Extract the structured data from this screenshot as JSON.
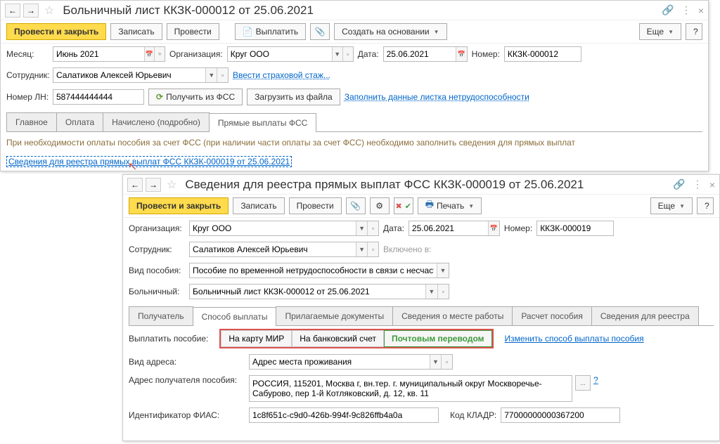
{
  "w1": {
    "title": "Больничный лист ККЗК-000012 от 25.06.2021",
    "toolbar": {
      "post_close": "Провести и закрыть",
      "write": "Записать",
      "post": "Провести",
      "payout": "Выплатить",
      "create_base": "Создать на основании",
      "more": "Еще",
      "help": "?"
    },
    "row1": {
      "month_lbl": "Месяц:",
      "month_val": "Июнь 2021",
      "org_lbl": "Организация:",
      "org_val": "Круг ООО",
      "date_lbl": "Дата:",
      "date_val": "25.06.2021",
      "num_lbl": "Номер:",
      "num_val": "ККЗК-000012"
    },
    "row2": {
      "emp_lbl": "Сотрудник:",
      "emp_val": "Салатиков Алексей Юрьевич",
      "stazh": "Ввести страховой стаж..."
    },
    "row3": {
      "ln_lbl": "Номер ЛН:",
      "ln_val": "587444444444",
      "get_fss": "Получить из ФСС",
      "load_file": "Загрузить из файла",
      "fill_link": "Заполнить данные листка нетрудоспособности"
    },
    "tabs": [
      "Главное",
      "Оплата",
      "Начислено (подробно)",
      "Прямые выплаты ФСС"
    ],
    "tab_info": "При необходимости оплаты пособия за счет ФСС (при наличии части оплаты за счет ФСС) необходимо заполнить сведения для прямых выплат",
    "registry_link": "Сведения для реестра прямых выплат ФСС ККЗК-000019 от 25.06.2021"
  },
  "w2": {
    "title": "Сведения для реестра прямых выплат ФСС ККЗК-000019 от 25.06.2021",
    "toolbar": {
      "post_close": "Провести и закрыть",
      "write": "Записать",
      "post": "Провести",
      "print": "Печать",
      "more": "Еще",
      "help": "?"
    },
    "row1": {
      "org_lbl": "Организация:",
      "org_val": "Круг ООО",
      "date_lbl": "Дата:",
      "date_val": "25.06.2021",
      "num_lbl": "Номер:",
      "num_val": "ККЗК-000019"
    },
    "row2": {
      "emp_lbl": "Сотрудник:",
      "emp_val": "Салатиков Алексей Юрьевич",
      "incl_lbl": "Включено в:"
    },
    "row3": {
      "kind_lbl": "Вид пособия:",
      "kind_val": "Пособие по временной нетрудоспособности в связи с несчаст"
    },
    "row4": {
      "sick_lbl": "Больничный:",
      "sick_val": "Больничный лист ККЗК-000012 от 25.06.2021"
    },
    "tabs": [
      "Получатель",
      "Способ выплаты",
      "Прилагаемые документы",
      "Сведения о месте работы",
      "Расчет пособия",
      "Сведения для реестра"
    ],
    "pay": {
      "lbl": "Выплатить пособие:",
      "opts": [
        "На карту МИР",
        "На банковский счет",
        "Почтовым переводом"
      ],
      "change": "Изменить способ выплаты пособия"
    },
    "addr_kind_lbl": "Вид адреса:",
    "addr_kind_val": "Адрес места проживания",
    "addr_lbl": "Адрес получателя пособия:",
    "addr_val": "РОССИЯ, 115201, Москва г, вн.тер. г. муниципальный округ Москворечье-Сабурово, пер 1-й Котляковский, д. 12, кв. 11",
    "fias_lbl": "Идентификатор ФИАС:",
    "fias_val": "1c8f651c-c9d0-426b-994f-9c826ffb4a0a",
    "kladr_lbl": "Код КЛАДР:",
    "kladr_val": "77000000000367200"
  }
}
